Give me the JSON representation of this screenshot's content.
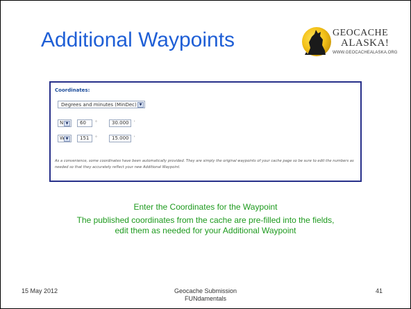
{
  "slide": {
    "title": "Additional Waypoints",
    "logo": {
      "line1": "GEOCACHE",
      "line2": "ALASKA!",
      "url": "WWW.GEOCACHEALASKA.ORG"
    }
  },
  "panel": {
    "label": "Coordinates:",
    "format_select": "Degrees and minutes (MinDec)",
    "lat": {
      "hemisphere": "N",
      "degrees": "60",
      "minutes": "30.000"
    },
    "lon": {
      "hemisphere": "W",
      "degrees": "151",
      "minutes": "15.000"
    },
    "degree_symbol": "°",
    "minute_symbol": "'",
    "note": "As a convenience, some coordinates have been automatically provided. They are simply the original waypoints of your cache page so be sure to edit the numbers as needed so that they accurately reflect your new Additional Waypoint."
  },
  "caption": {
    "line1": "Enter the Coordinates for the Waypoint",
    "line2": "The published coordinates from the cache are pre-filled into the fields,",
    "line3": "edit them as needed for your Additional Waypoint"
  },
  "footer": {
    "date": "15 May 2012",
    "center_line1": "Geocache Submission",
    "center_line2": "FUNdamentals",
    "page_number": "41"
  },
  "colors": {
    "title": "#1f5fd6",
    "caption": "#1e9a1e",
    "panel_border": "#27308a"
  }
}
